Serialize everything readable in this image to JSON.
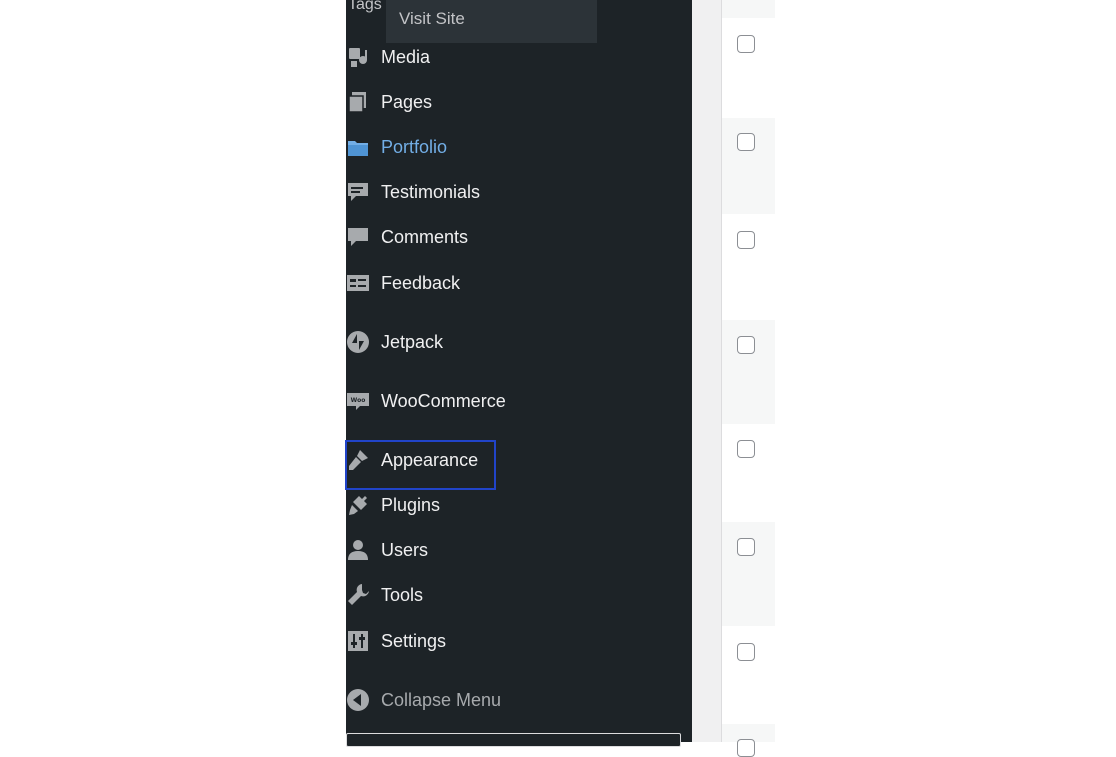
{
  "admin_bar": {
    "partial_label": "Tags",
    "visit_site": "Visit Site"
  },
  "sidebar": {
    "items": [
      {
        "label": "Media",
        "icon": "media-icon"
      },
      {
        "label": "Pages",
        "icon": "pages-icon"
      },
      {
        "label": "Portfolio",
        "icon": "portfolio-folder-icon",
        "active": true
      },
      {
        "label": "Testimonials",
        "icon": "testimonials-icon"
      },
      {
        "label": "Comments",
        "icon": "comments-icon"
      },
      {
        "label": "Feedback",
        "icon": "feedback-icon"
      },
      {
        "label": "Jetpack",
        "icon": "jetpack-icon"
      },
      {
        "label": "WooCommerce",
        "icon": "woocommerce-icon"
      },
      {
        "label": "Appearance",
        "icon": "appearance-brush-icon",
        "focused": true
      },
      {
        "label": "Plugins",
        "icon": "plugins-icon"
      },
      {
        "label": "Users",
        "icon": "users-icon"
      },
      {
        "label": "Tools",
        "icon": "tools-wrench-icon"
      },
      {
        "label": "Settings",
        "icon": "settings-sliders-icon"
      }
    ],
    "collapse_label": "Collapse Menu"
  },
  "colors": {
    "sidebar_bg": "#1d2327",
    "submenu_bg": "#2c3338",
    "text": "#f0f0f1",
    "active": "#72aee6",
    "focus_outline": "#2144c9"
  }
}
